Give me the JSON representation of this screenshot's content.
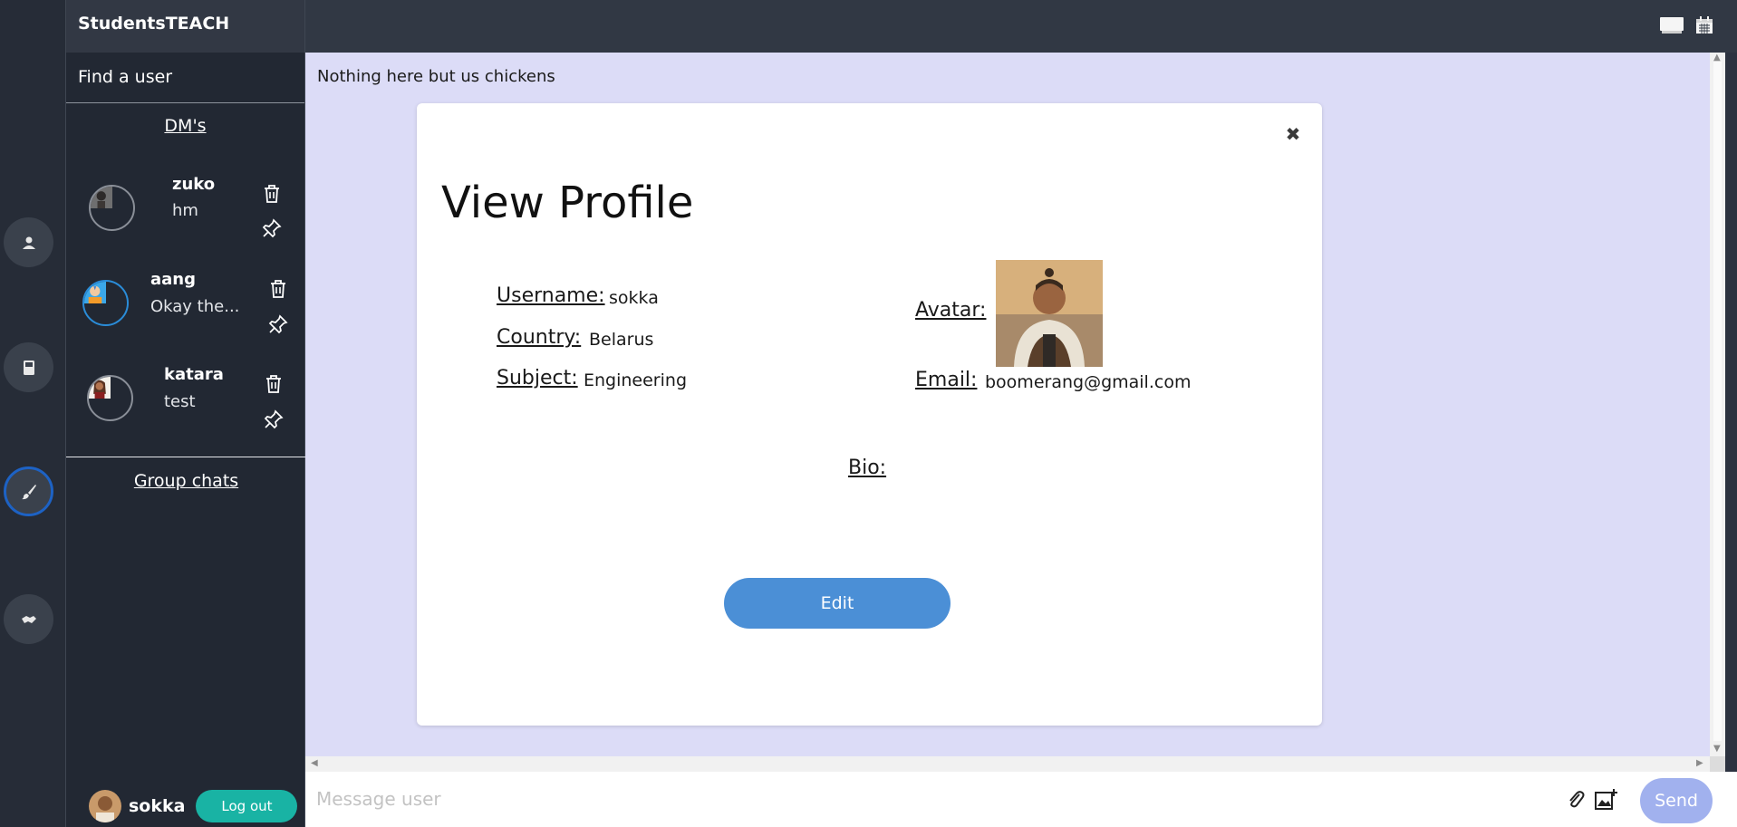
{
  "app": {
    "brand": "StudentsTEACH"
  },
  "rail": {
    "items": [
      {
        "icon": "user-icon"
      },
      {
        "icon": "book-icon"
      },
      {
        "icon": "paintbrush-icon",
        "active": true
      },
      {
        "icon": "handshake-icon"
      }
    ]
  },
  "sidebar": {
    "find_user": "Find a user",
    "dms_title": "DM's",
    "dms": [
      {
        "name": "zuko",
        "last_message": "hm"
      },
      {
        "name": "aang",
        "last_message": "Okay the..."
      },
      {
        "name": "katara",
        "last_message": "test"
      }
    ],
    "group_chats_title": "Group chats",
    "current_user": "sokka",
    "logout_label": "Log out"
  },
  "chat": {
    "empty_note": "Nothing here but us chickens",
    "composer_placeholder": "Message user",
    "send_label": "Send"
  },
  "modal": {
    "title": "View Profile",
    "close_symbol": "✖",
    "username_label": "Username:",
    "username": "sokka",
    "country_label": "Country:",
    "country": "Belarus",
    "subject_label": "Subject:",
    "subject": "Engineering",
    "avatar_label": "Avatar:",
    "email_label": "Email:",
    "email": "boomerang@gmail.com",
    "bio_label": "Bio:",
    "edit_label": "Edit"
  },
  "colors": {
    "accent_blue": "#4b8fd6",
    "logout_teal": "#19b3a4",
    "send_button": "#a1b1ee",
    "chat_background": "#dcdcf7",
    "active_ring": "#1d62c4"
  }
}
